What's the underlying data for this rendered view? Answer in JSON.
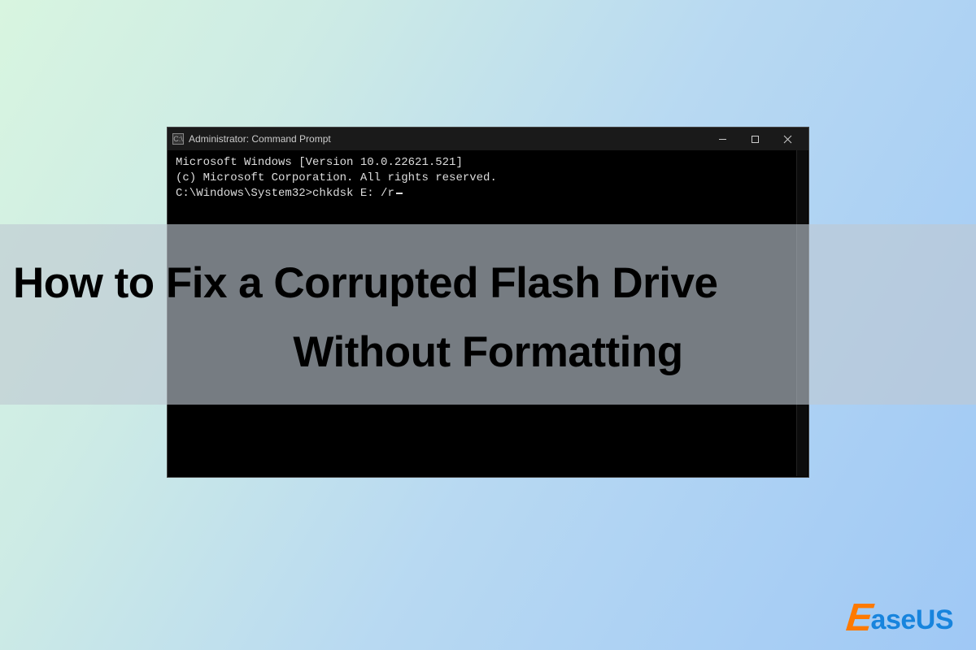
{
  "window": {
    "title": "Administrator: Command Prompt",
    "icon_name": "cmd-icon"
  },
  "terminal": {
    "lines": [
      "Microsoft Windows [Version 10.0.22621.521]",
      "(c) Microsoft Corporation. All rights reserved.",
      "",
      "C:\\Windows\\System32>chkdsk E: /r"
    ]
  },
  "headline": {
    "line1": "How to Fix a Corrupted Flash Drive",
    "line2": "Without Formatting"
  },
  "logo": {
    "first_letter": "E",
    "rest": "aseUS"
  }
}
